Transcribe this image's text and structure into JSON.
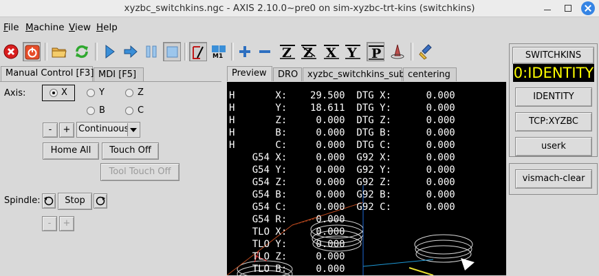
{
  "window": {
    "title": "xyzbc_switchkins.ngc - AXIS 2.10.0~pre0 on sim-xyzbc-trt-kins (switchkins)"
  },
  "menu": [
    {
      "label": "File",
      "mnemonic": "F",
      "rest": "ile"
    },
    {
      "label": "Machine",
      "mnemonic": "M",
      "rest": "achine"
    },
    {
      "label": "View",
      "mnemonic": "V",
      "rest": "iew"
    },
    {
      "label": "Help",
      "mnemonic": "H",
      "rest": "elp"
    }
  ],
  "toolbar": {
    "icons": [
      "estop-icon",
      "machine-power-icon",
      "open-file-icon",
      "reload-icon",
      "run-icon",
      "step-icon",
      "pause-icon",
      "stop-icon",
      "blockdelete-icon",
      "optional-stop-icon",
      "zoom-in-icon",
      "zoom-out-icon",
      "view-z-icon",
      "view-z2-icon",
      "view-x-icon",
      "view-y-icon",
      "view-p-icon",
      "rotate-view-icon",
      "clear-plot-icon"
    ],
    "view_letters": {
      "z": "Z",
      "z2": "Z",
      "x": "X",
      "y": "Y",
      "p": "P"
    }
  },
  "left_tabs": [
    "Manual Control [F3]",
    "MDI [F5]"
  ],
  "manual": {
    "axis_label": "Axis:",
    "axes": [
      {
        "label": "X",
        "selected": true
      },
      {
        "label": "Y",
        "selected": false
      },
      {
        "label": "Z",
        "selected": false
      },
      {
        "label": "B",
        "selected": false
      },
      {
        "label": "C",
        "selected": false
      }
    ],
    "minus": "-",
    "plus": "+",
    "jog_mode": "Continuous",
    "home_all": "Home All",
    "touch_off": "Touch Off",
    "tool_touch_off": "Tool Touch Off",
    "spindle_label": "Spindle:",
    "spindle_stop": "Stop",
    "spindle_minus": "-",
    "spindle_plus": "+"
  },
  "preview_tabs": [
    "Preview",
    "DRO",
    "xyzbc_switchkins_sub",
    "centering"
  ],
  "dro": [
    "H       X:    29.500  DTG X:      0.000",
    "H       Y:    18.611  DTG Y:      0.000",
    "H       Z:     0.000  DTG Z:      0.000",
    "H       B:     0.000  DTG B:      0.000",
    "H       C:     0.000  DTG C:      0.000",
    "    G54 X:     0.000  G92 X:      0.000",
    "    G54 Y:     0.000  G92 Y:      0.000",
    "    G54 Z:     0.000  G92 Z:      0.000",
    "    G54 B:     0.000  G92 B:      0.000",
    "    G54 C:     0.000  G92 C:      0.000",
    "    G54 R:     0.000",
    "    TLO X:     0.000",
    "    TLO Y:     0.000",
    "    TLO Z:     0.000",
    "    TLO B:     0.000"
  ],
  "switchkins": {
    "header": "SWITCHKINS",
    "display": "0:IDENTITY",
    "buttons": [
      "IDENTITY",
      "TCP:XYZBC",
      "userk"
    ],
    "clear_button": "vismach-clear"
  },
  "colors": {
    "display_text": "#ffff00",
    "estop": "#d81e1e",
    "title_close": "#3584e4"
  }
}
